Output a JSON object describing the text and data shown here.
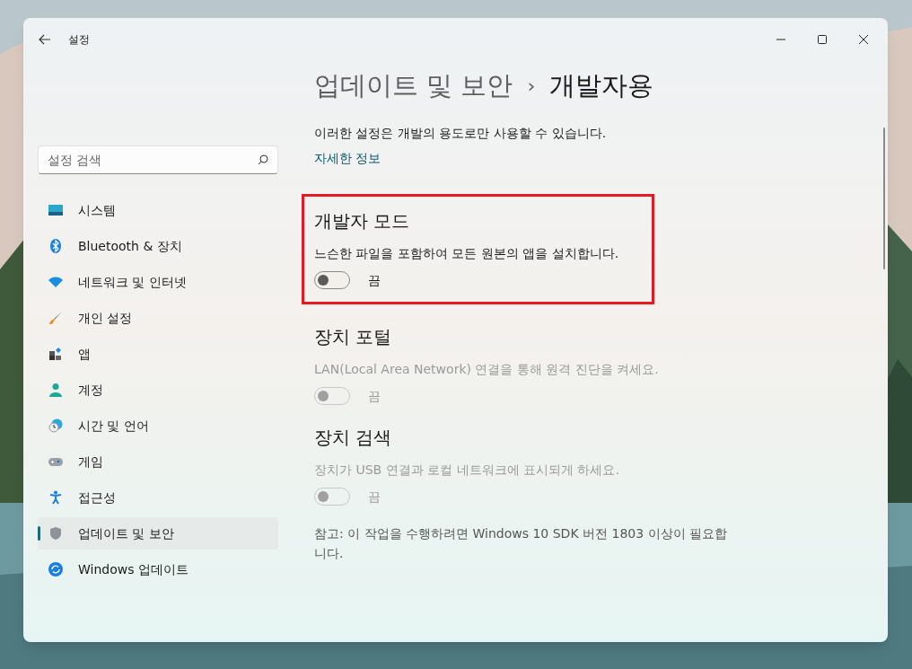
{
  "window": {
    "title": "설정"
  },
  "search": {
    "placeholder": "설정 검색"
  },
  "sidebar": {
    "items": [
      {
        "label": "시스템",
        "selected": false
      },
      {
        "label": "Bluetooth & 장치",
        "selected": false
      },
      {
        "label": "네트워크 및 인터넷",
        "selected": false
      },
      {
        "label": "개인 설정",
        "selected": false
      },
      {
        "label": "앱",
        "selected": false
      },
      {
        "label": "계정",
        "selected": false
      },
      {
        "label": "시간 및 언어",
        "selected": false
      },
      {
        "label": "게임",
        "selected": false
      },
      {
        "label": "접근성",
        "selected": false
      },
      {
        "label": "업데이트 및 보안",
        "selected": true
      },
      {
        "label": "Windows 업데이트",
        "selected": false
      }
    ]
  },
  "breadcrumb": {
    "parent": "업데이트 및 보안",
    "separator": "›",
    "current": "개발자용"
  },
  "intro": "이러한 설정은 개발의 용도로만 사용할 수 있습니다.",
  "more_info_link": "자세한 정보",
  "sections": [
    {
      "title": "개발자 모드",
      "description": "느슨한 파일을 포함하여 모든 원본의 앱을 설치합니다.",
      "toggle_label": "끔",
      "on": false,
      "disabled": false,
      "highlighted": true
    },
    {
      "title": "장치 포털",
      "description": "LAN(Local Area Network) 연결을 통해 원격 진단을 켜세요.",
      "toggle_label": "끔",
      "on": false,
      "disabled": true
    },
    {
      "title": "장치 검색",
      "description": "장치가 USB 연결과 로컬 네트워크에 표시되게 하세요.",
      "toggle_label": "끔",
      "on": false,
      "disabled": true,
      "note": "참고: 이 작업을 수행하려면 Windows 10 SDK 버전 1803 이상이 필요합니다."
    }
  ]
}
